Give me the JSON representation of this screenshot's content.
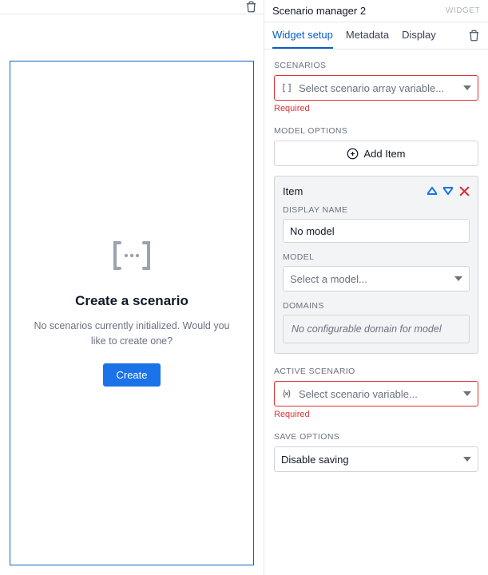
{
  "left": {
    "preview": {
      "title": "Create a scenario",
      "description": "No scenarios currently initialized. Would you like to create one?",
      "button": "Create"
    }
  },
  "right": {
    "title": "Scenario manager 2",
    "badge": "WIDGET",
    "tabs": [
      "Widget setup",
      "Metadata",
      "Display"
    ],
    "active_tab": 0,
    "scenarios": {
      "label": "SCENARIOS",
      "placeholder": "Select scenario array variable...",
      "required": "Required"
    },
    "model_options": {
      "label": "MODEL OPTIONS",
      "add": "Add Item",
      "item": {
        "title": "Item",
        "display_name_label": "DISPLAY NAME",
        "display_name_value": "No model",
        "model_label": "MODEL",
        "model_placeholder": "Select a model...",
        "domains_label": "DOMAINS",
        "domains_empty": "No configurable domain for model"
      }
    },
    "active_scenario": {
      "label": "ACTIVE SCENARIO",
      "placeholder": "Select scenario variable...",
      "required": "Required"
    },
    "save_options": {
      "label": "SAVE OPTIONS",
      "value": "Disable saving"
    }
  }
}
